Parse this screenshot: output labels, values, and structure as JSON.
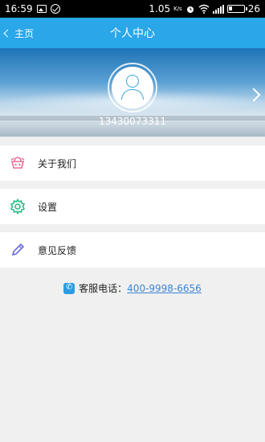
{
  "status_bar": {
    "time": "16:59",
    "data_rate": "1.05",
    "data_rate_unit": "K/s",
    "battery_level": "26",
    "icons": [
      "image-icon",
      "check-circle-icon",
      "alarm-icon",
      "wifi-icon",
      "signal-icon",
      "battery-icon"
    ]
  },
  "nav": {
    "back_label": "主页",
    "title": "个人中心"
  },
  "profile": {
    "phone_number": "13430073311"
  },
  "menu": [
    {
      "label": "关于我们",
      "icon": "about-us-icon"
    },
    {
      "label": "设置",
      "icon": "gear-icon"
    },
    {
      "label": "意见反馈",
      "icon": "pencil-icon"
    }
  ],
  "contact": {
    "label": "客服电话：",
    "phone": "400-9998-6656"
  },
  "colors": {
    "nav": "#29a7e8",
    "link": "#3b86d8",
    "about_icon": "#e46f95",
    "gear_icon": "#2fbb87",
    "pencil_icon": "#6b6fd8"
  }
}
